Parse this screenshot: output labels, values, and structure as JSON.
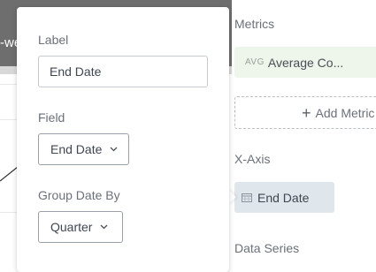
{
  "background": {
    "header_text": "-we"
  },
  "popover": {
    "label_title": "Label",
    "label_value": "End Date",
    "field_title": "Field",
    "field_value": "End Date",
    "group_title": "Group Date By",
    "group_value": "Quarter"
  },
  "right_panel": {
    "metrics_title": "Metrics",
    "metric": {
      "aggregation": "AVG",
      "name": "Average Co..."
    },
    "add_metric_label": "Add Metric",
    "xaxis_title": "X-Axis",
    "xaxis_field": "End Date",
    "series_title": "Data Series"
  },
  "icons": {
    "plus": "plus-icon",
    "calendar": "calendar-icon",
    "chevron": "chevron-down-icon"
  },
  "colors": {
    "metric_pill": "#eef5ea",
    "xaxis_pill": "#dfe6ec",
    "header_bg": "#6e6e6e"
  }
}
